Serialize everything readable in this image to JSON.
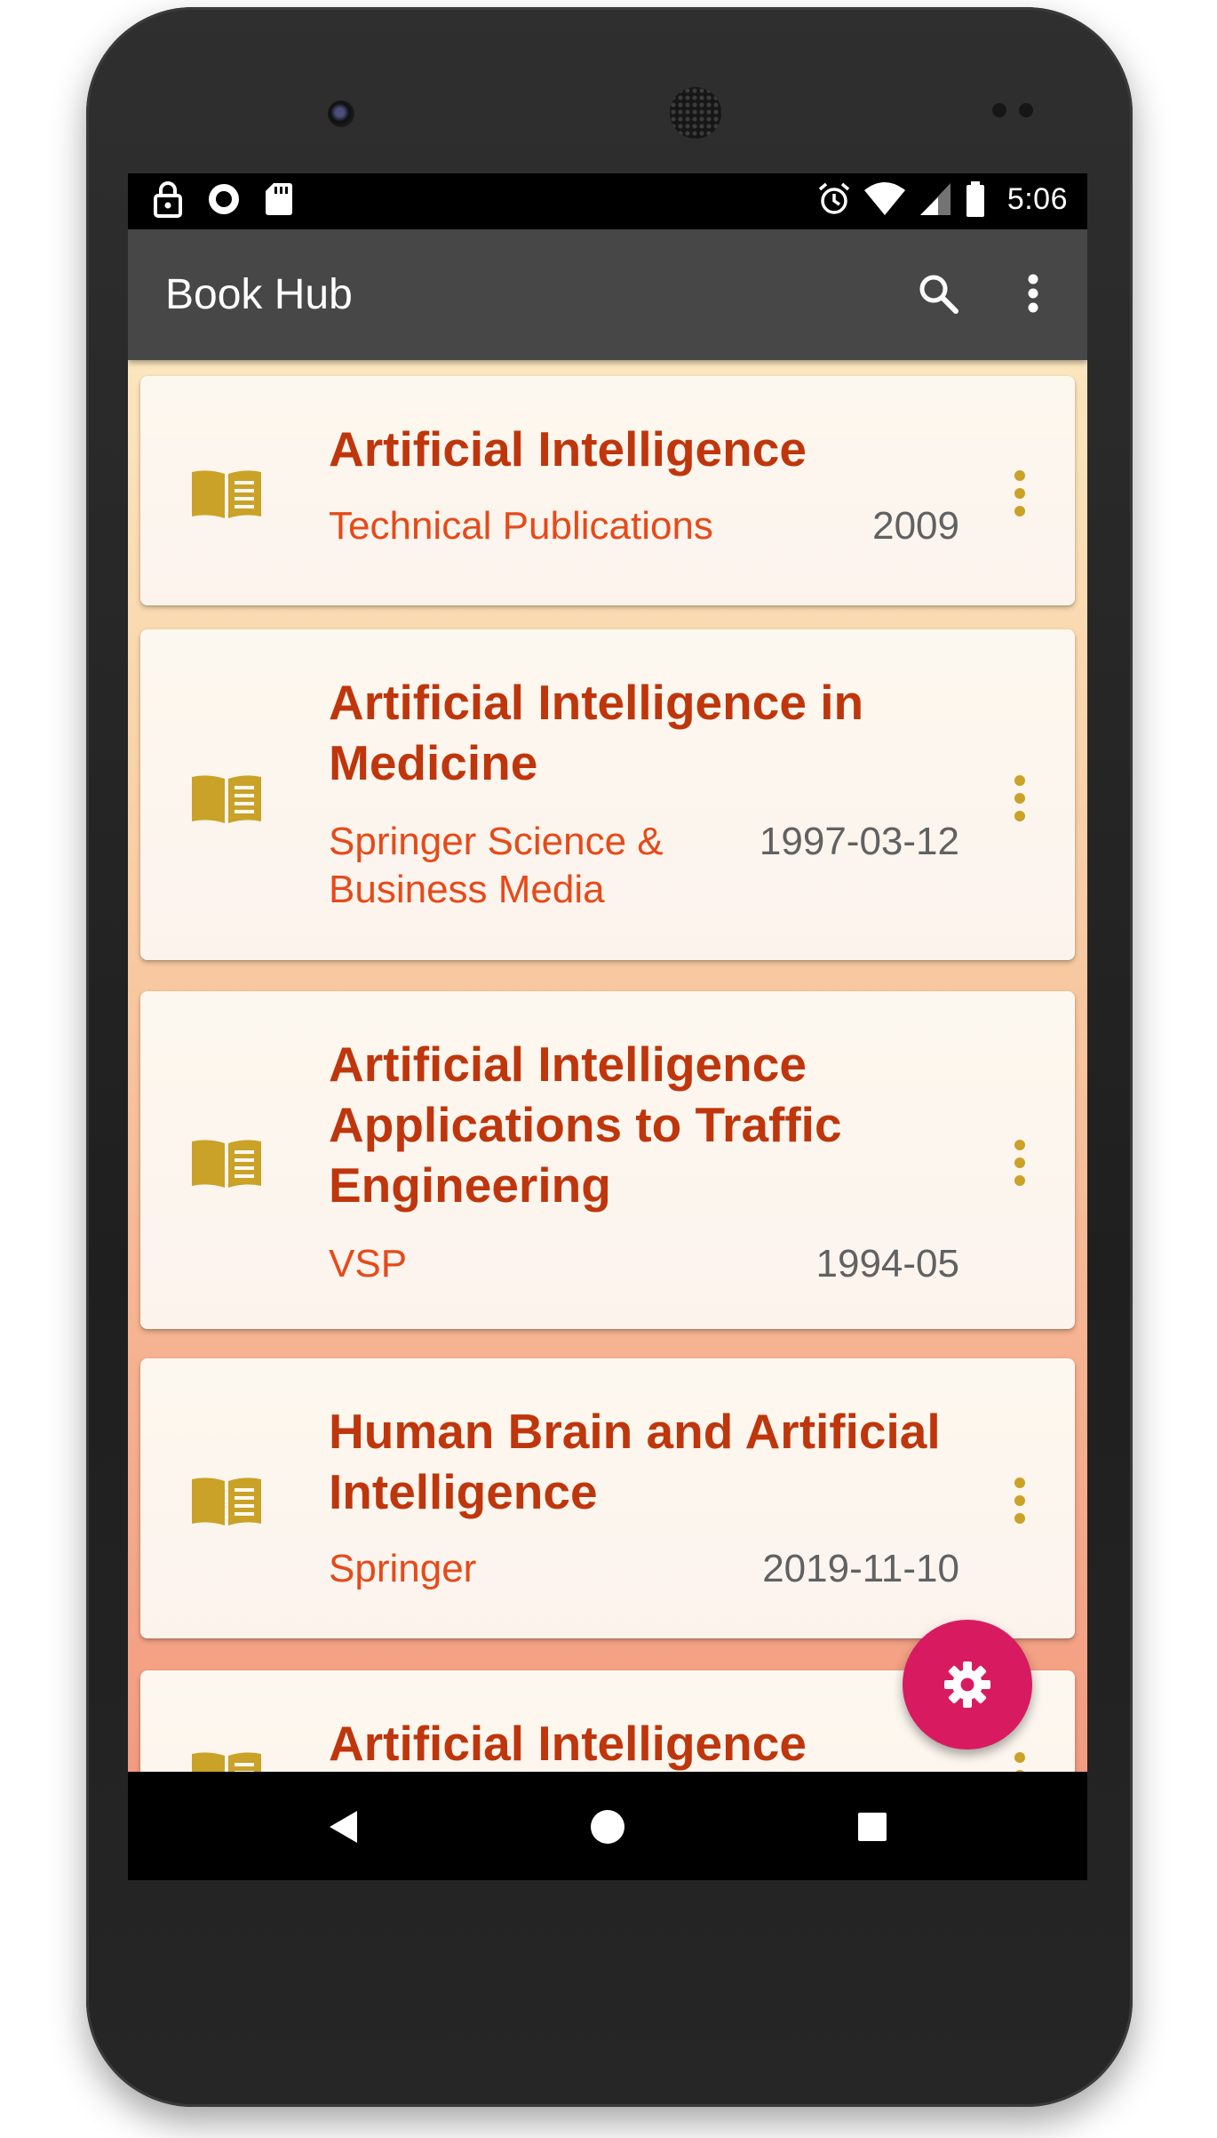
{
  "status_bar": {
    "left_icons": [
      "lock-icon",
      "sync-circle-icon",
      "sd-card-icon"
    ],
    "right_icons": [
      "alarm-icon",
      "wifi-icon",
      "signal-icon",
      "battery-icon"
    ],
    "time": "5:06"
  },
  "app_bar": {
    "title": "Book Hub",
    "actions": [
      "search-icon",
      "more-vertical-icon"
    ]
  },
  "books": [
    {
      "title": "Artificial Intelligence",
      "publisher": "Technical Publications",
      "date": "2009"
    },
    {
      "title": "Artificial Intelligence in Medicine",
      "publisher": "Springer Science & Business Media",
      "date": "1997-03-12"
    },
    {
      "title": "Artificial Intelligence Applications to Traffic Engineering",
      "publisher": "VSP",
      "date": "1994-05"
    },
    {
      "title": "Human Brain and Artificial Intelligence",
      "publisher": "Springer",
      "date": "2019-11-10"
    },
    {
      "title": "Artificial Intelligence",
      "publisher": "",
      "date": ""
    }
  ],
  "fab": {
    "icon": "settings-gear-icon",
    "color": "#d81b60"
  },
  "nav_bar": {
    "buttons": [
      "back-triangle-icon",
      "home-circle-icon",
      "recents-square-icon"
    ]
  },
  "colors": {
    "app_bar": "#474747",
    "title_text": "#bf360c",
    "publisher_text": "#e64a19",
    "date_text": "#616161",
    "icon_gold": "#c9a227",
    "background_top": "#fbe6be",
    "background_bottom": "#f39b80"
  }
}
